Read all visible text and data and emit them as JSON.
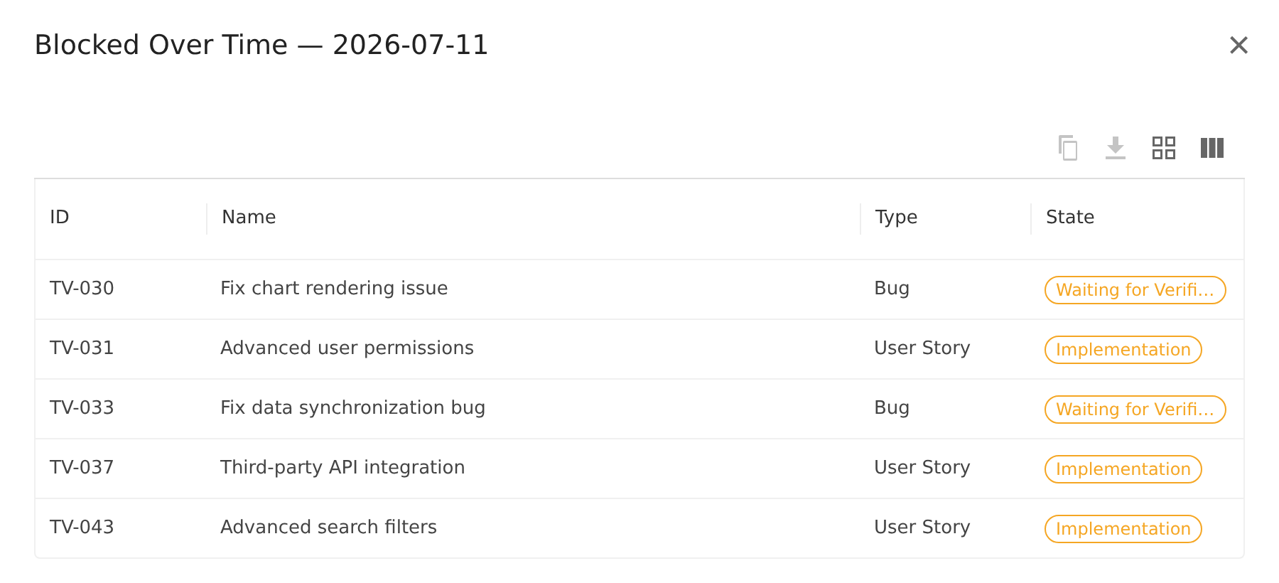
{
  "dialog": {
    "title": "Blocked Over Time — 2026-07-11",
    "close": "×"
  },
  "toolbar": [
    {
      "kind": "copy",
      "disabled": true
    },
    {
      "kind": "download",
      "disabled": true
    },
    {
      "kind": "grid",
      "disabled": false
    },
    {
      "kind": "columns",
      "disabled": false
    }
  ],
  "table": {
    "columns": [
      "ID",
      "Name",
      "Type",
      "State"
    ],
    "rows": [
      {
        "id": "TV-030",
        "name": "Fix chart rendering issue",
        "type": "Bug",
        "state": "Waiting for Verifi…"
      },
      {
        "id": "TV-031",
        "name": "Advanced user permissions",
        "type": "User Story",
        "state": "Implementation"
      },
      {
        "id": "TV-033",
        "name": "Fix data synchronization bug",
        "type": "Bug",
        "state": "Waiting for Verifi…"
      },
      {
        "id": "TV-037",
        "name": "Third-party API integration",
        "type": "User Story",
        "state": "Implementation"
      },
      {
        "id": "TV-043",
        "name": "Advanced search filters",
        "type": "User Story",
        "state": "Implementation"
      }
    ]
  }
}
